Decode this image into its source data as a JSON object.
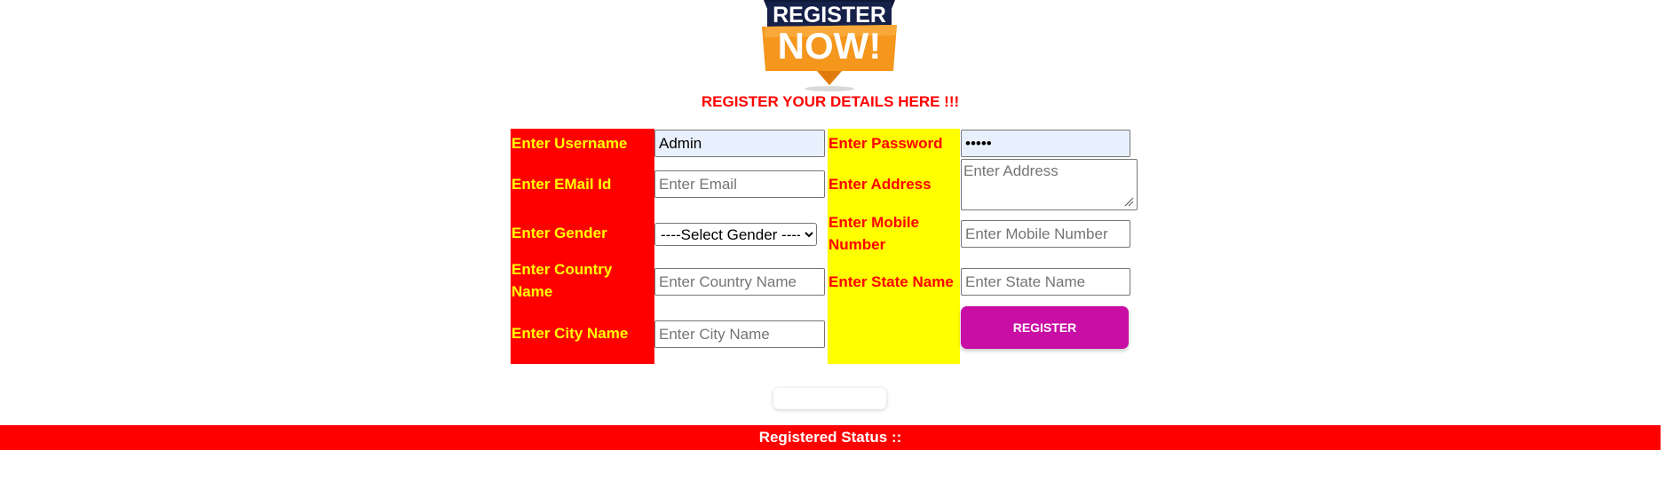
{
  "logo": {
    "line1": "REGISTER",
    "line2": "NOW!"
  },
  "subtitle": "REGISTER YOUR DETAILS HERE !!!",
  "form": {
    "username": {
      "label": "Enter Username",
      "value": "Admin"
    },
    "password": {
      "label": "Enter Password",
      "value": "•••••"
    },
    "email": {
      "label": "Enter EMail Id",
      "placeholder": "Enter Email"
    },
    "address": {
      "label": "Enter Address",
      "placeholder": "Enter Address"
    },
    "gender": {
      "label": "Enter Gender",
      "selected": "----Select Gender ----"
    },
    "mobile": {
      "label": "Enter Mobile Number",
      "placeholder": "Enter Mobile Number"
    },
    "country": {
      "label": "Enter Country Name",
      "placeholder": "Enter Country Name"
    },
    "state": {
      "label": "Enter State Name",
      "placeholder": "Enter State Name"
    },
    "city": {
      "label": "Enter City Name",
      "placeholder": "Enter City Name"
    },
    "submit_label": "REGISTER"
  },
  "status": {
    "label": "Registered Status ::"
  },
  "colors": {
    "label_panel_left": "#ff0000",
    "label_panel_right": "#ffff00",
    "button": "#c90ea5",
    "status_bar": "#ff0000",
    "logo_navy": "#16214a",
    "logo_orange": "#f5961d"
  }
}
